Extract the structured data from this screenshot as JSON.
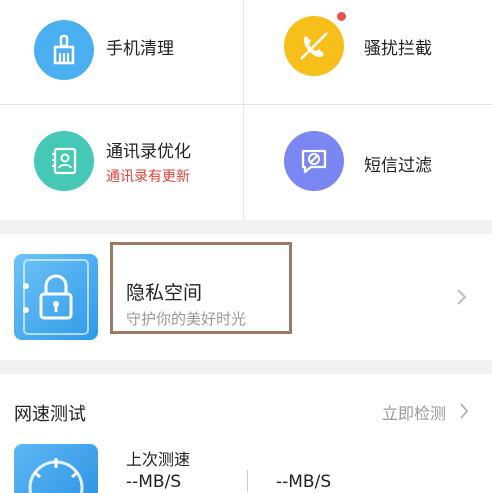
{
  "grid": {
    "items": [
      {
        "label": "手机清理",
        "icon": "broom-icon",
        "color": "#4ab0f2"
      },
      {
        "label": "骚扰拦截",
        "icon": "blocked-phone-icon",
        "color": "#f7bf1a",
        "badge": true
      },
      {
        "label": "通讯录优化",
        "sub": "通讯录有更新",
        "icon": "contacts-icon",
        "color": "#45c9b6"
      },
      {
        "label": "短信过滤",
        "icon": "message-filter-icon",
        "color": "#7a86f2"
      }
    ]
  },
  "privacy": {
    "title": "隐私空间",
    "subtitle": "守护你的美好时光"
  },
  "speed": {
    "title": "网速测试",
    "action": "立即检测",
    "last_label": "上次测速",
    "value1": "--MB/S",
    "value2": "--MB/S"
  },
  "colors": {
    "alert": "#e0453b",
    "highlight_border": "#9b7b63"
  }
}
